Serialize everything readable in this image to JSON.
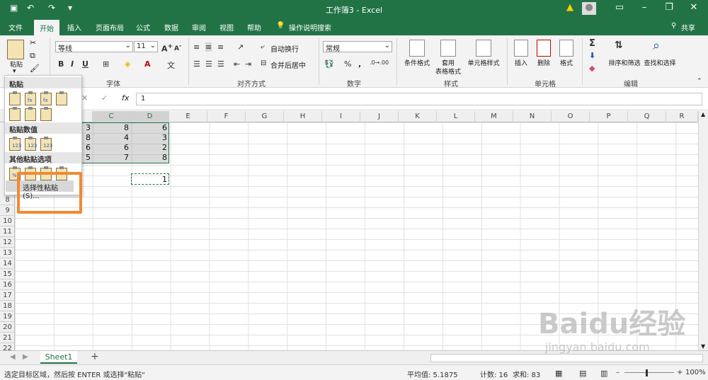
{
  "titlebar": {
    "title": "工作簿3  -  Excel",
    "warn_icon": "warning-icon",
    "bg": "#217346"
  },
  "tabs": [
    "文件",
    "开始",
    "插入",
    "页面布局",
    "公式",
    "数据",
    "审阅",
    "视图",
    "帮助",
    "操作说明搜索"
  ],
  "share": "共享",
  "ribbon": {
    "paste": "粘贴",
    "font_name": "等线",
    "font_size": "11",
    "bold": "B",
    "italic": "I",
    "underline": "U",
    "wrap": "自动换行",
    "merge": "合并后居中",
    "number_format": "常规",
    "percent": "%",
    "comma": ",",
    "cond_format": "条件格式",
    "table_format_1": "套用",
    "table_format_2": "表格格式",
    "cell_style": "单元格样式",
    "insert": "插入",
    "delete": "删除",
    "format": "格式",
    "sort_filter": "排序和筛选",
    "find_select": "查找和选择",
    "groups": {
      "font": "字体",
      "align": "对齐方式",
      "number": "数字",
      "style": "样式",
      "cells": "单元格",
      "edit": "编辑"
    }
  },
  "formula_bar": {
    "fx": "fx",
    "value": "1",
    "cancel": "✕",
    "confirm": "✓"
  },
  "columns": [
    "C",
    "D",
    "E",
    "F",
    "G",
    "H",
    "I",
    "J",
    "K",
    "L",
    "M",
    "N",
    "O",
    "P",
    "Q",
    "R"
  ],
  "rows": [
    "8",
    "9",
    "10",
    "11",
    "12",
    "13",
    "14",
    "15",
    "16",
    "17",
    "18",
    "19",
    "20",
    "21",
    "22"
  ],
  "cells": {
    "b": [
      "3",
      "8",
      "6",
      "5"
    ],
    "c": [
      "8",
      "4",
      "6",
      "7"
    ],
    "d": [
      "6",
      "3",
      "2",
      "8"
    ],
    "clip": "1"
  },
  "paste_menu": {
    "header_paste": "粘贴",
    "header_values": "粘贴数值",
    "header_other": "其他粘贴选项",
    "paste_special": "选择性粘贴(S)...",
    "sub_fx": "fx",
    "sub_123": "123",
    "sub_pct": "%"
  },
  "sheet": {
    "name": "Sheet1",
    "add": "+"
  },
  "status": {
    "message": "选定目标区域，然后按 ENTER 或选择\"粘贴\"",
    "average": "平均值: 5.1875",
    "count": "计数: 16",
    "sum": "求和: 83",
    "zoom": "100%"
  },
  "watermark": {
    "brand": "Baidu经验",
    "url": "jingyan.baidu.com"
  }
}
